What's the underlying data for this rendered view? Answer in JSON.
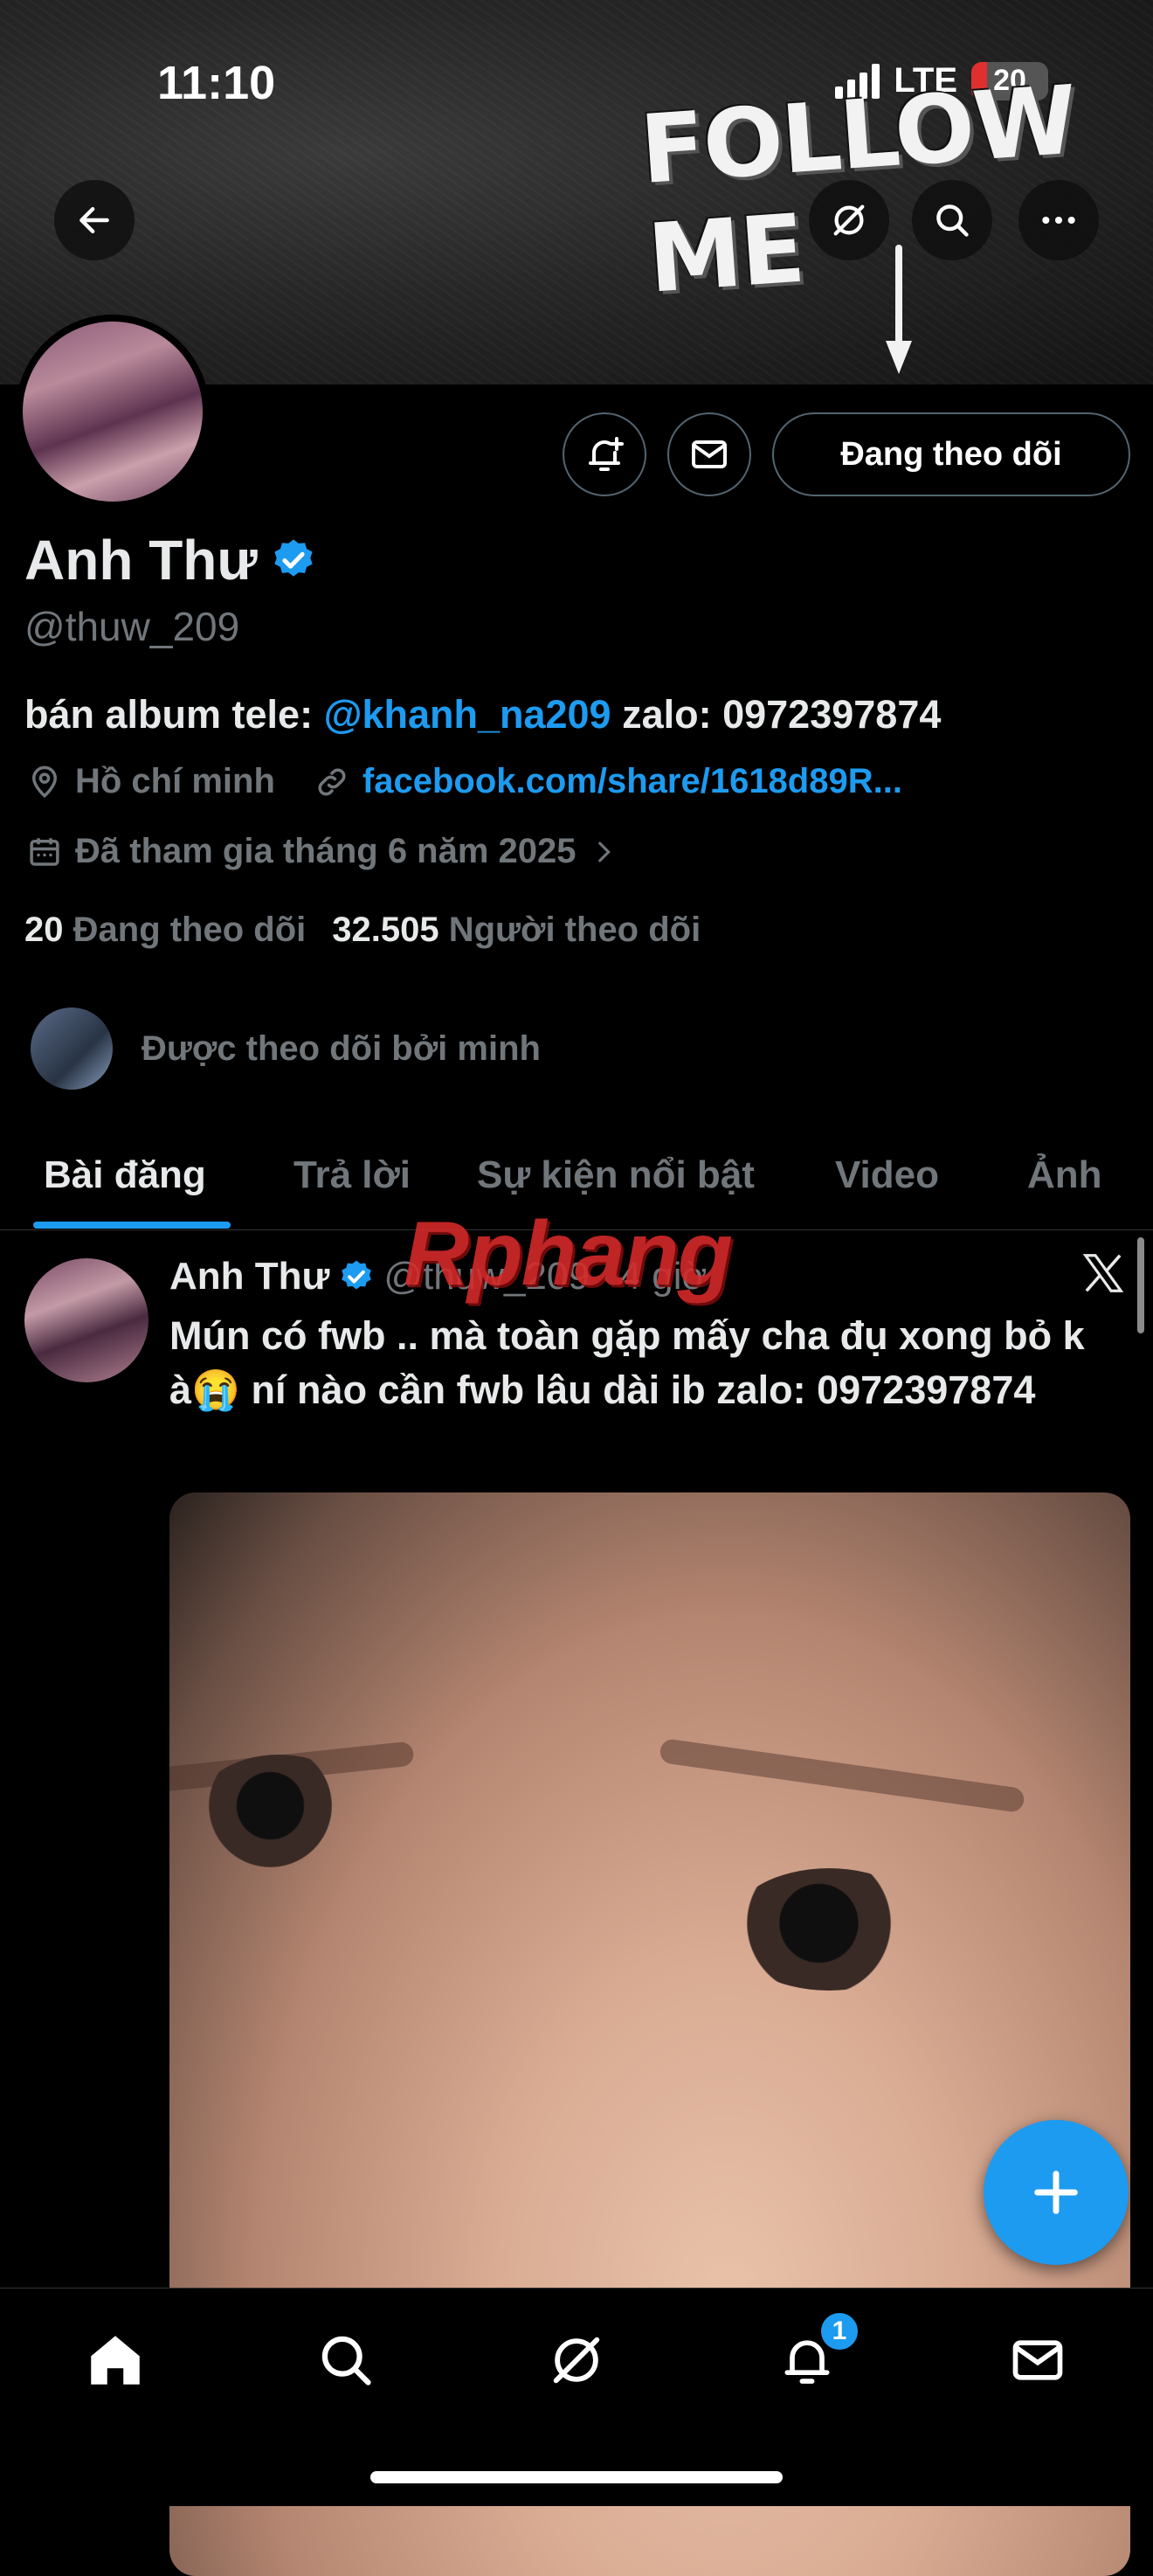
{
  "status_bar": {
    "time": "11:10",
    "network": "LTE",
    "battery": "20",
    "battery_fraction": 0.2
  },
  "banner": {
    "overlay_text": "FOLLOW ME"
  },
  "header": {
    "back_icon": "arrow-left-icon",
    "grok_icon": "grok-icon",
    "search_icon": "search-icon",
    "more_icon": "more-icon"
  },
  "profile": {
    "name": "Anh Thư",
    "verified": true,
    "handle": "@thuw_209",
    "bio_prefix": "bán album tele: ",
    "bio_mention": "@khanh_na209",
    "bio_suffix": " zalo: 0972397874",
    "location": "Hồ chí minh",
    "website": "facebook.com/share/1618d89R...",
    "joined": "Đã tham gia tháng 6 năm 2025",
    "following_count": "20",
    "following_label": "Đang theo dõi",
    "followers_count": "32.505",
    "followers_label": "Người theo dõi",
    "followed_by": "Được theo dõi bởi minh",
    "following_button": "Đang theo dõi"
  },
  "tabs": [
    {
      "label": "Bài đăng",
      "active": true
    },
    {
      "label": "Trả lời",
      "active": false
    },
    {
      "label": "Sự kiện nổi bật",
      "active": false
    },
    {
      "label": "Video",
      "active": false
    },
    {
      "label": "Ảnh",
      "active": false
    }
  ],
  "post": {
    "author": "Anh Thư",
    "handle": "@thuw_209",
    "separator": "·",
    "time": "4 giờ",
    "text": "Mún có fwb .. mà toàn gặp mấy cha đụ xong bỏ k à😭 ní nào cần fwb lâu dài ib zalo: 0972397874"
  },
  "watermark": "Rphang",
  "bottom_nav": {
    "items": [
      "home-icon",
      "search-icon",
      "grok-icon",
      "notifications-icon",
      "messages-icon"
    ],
    "notification_badge": "1"
  },
  "colors": {
    "accent": "#1d9bf0",
    "muted": "#71767b",
    "text": "#e7e9ea",
    "background": "#000000"
  }
}
